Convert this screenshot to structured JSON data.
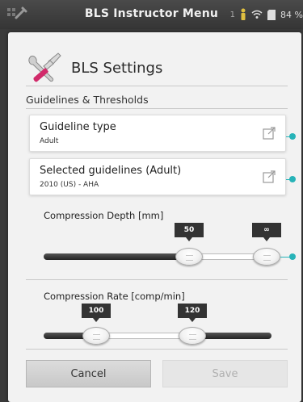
{
  "statusbar": {
    "title": "BLS Instructor Menu",
    "battery_text": "84 %",
    "notification_count": "1"
  },
  "dialog": {
    "title": "BLS Settings",
    "section_guidelines": "Guidelines & Thresholds",
    "guideline_type": {
      "label": "Guideline type",
      "value": "Adult"
    },
    "selected_guidelines": {
      "label": "Selected guidelines (Adult)",
      "value": "2010 (US) - AHA"
    },
    "compression_depth": {
      "label": "Compression Depth [mm]",
      "low_value": "50",
      "high_value": "∞"
    },
    "compression_rate": {
      "label": "Compression Rate [comp/min]",
      "low_value": "100",
      "high_value": "120"
    },
    "buttons": {
      "cancel": "Cancel",
      "save": "Save"
    }
  },
  "colors": {
    "accent": "#27b3b8",
    "tooltip": "#333333",
    "save_disabled_text": "#b0b0b0"
  },
  "icons": {
    "app": "wrench-icon",
    "header": "tools-icon",
    "external": "external-link-icon"
  }
}
